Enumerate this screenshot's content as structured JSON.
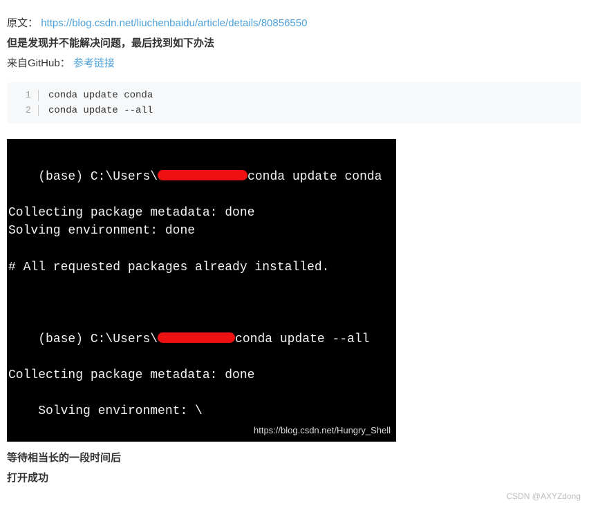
{
  "source": {
    "label": "原文：",
    "url_text": "https://blog.csdn.net/liuchenbaidu/article/details/80856550"
  },
  "bold_intro": "但是发现并不能解决问题，最后找到如下办法",
  "github": {
    "label": "来自GitHub：",
    "link_text": "参考链接"
  },
  "code": {
    "lines": [
      {
        "n": "1",
        "text": "conda update conda"
      },
      {
        "n": "2",
        "text": "conda update --all"
      }
    ]
  },
  "terminal": {
    "prompt_prefix": "(base) C:\\Users\\",
    "cmd1_suffix": "conda update conda",
    "line_collect": "Collecting package metadata: done",
    "line_solve_done": "Solving environment: done",
    "line_installed": "# All requested packages already installed.",
    "cmd2_suffix": "conda update --all",
    "line_solve_wait": "Solving environment: \\ ",
    "inner_watermark": "https://blog.csdn.net/Hungry_Shell"
  },
  "after1": "等待相当长的一段时间后",
  "after2": "打开成功",
  "watermark": "CSDN @AXYZdong"
}
